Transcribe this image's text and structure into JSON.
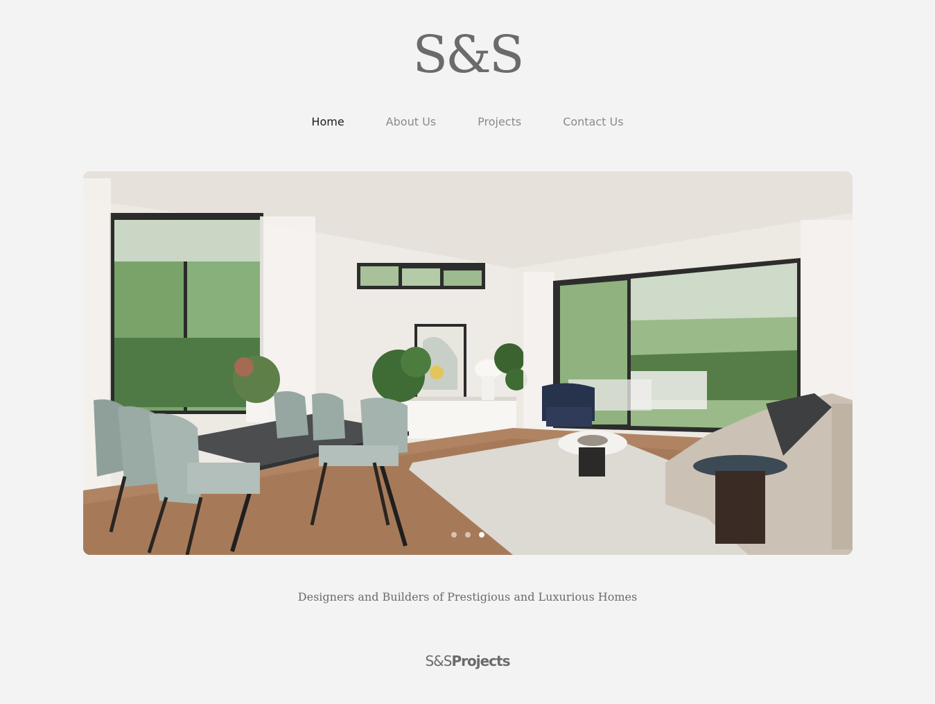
{
  "logo": {
    "text": "S&S"
  },
  "nav": {
    "items": [
      {
        "label": "Home",
        "active": true
      },
      {
        "label": "About Us",
        "active": false
      },
      {
        "label": "Projects",
        "active": false
      },
      {
        "label": "Contact Us",
        "active": false
      }
    ]
  },
  "hero": {
    "image_subject": "modern living and dining room interior with garden views",
    "slides_count": 3,
    "active_slide": 3
  },
  "tagline": "Designers and Builders of Prestigious and Luxurious Homes",
  "footer_brand": {
    "light": "S&S",
    "bold": "Projects"
  },
  "colors": {
    "background": "#f3f3f3",
    "text_muted": "#8a8a8a",
    "text_active": "#1b1b1b",
    "logo": "#6b6b6b"
  }
}
